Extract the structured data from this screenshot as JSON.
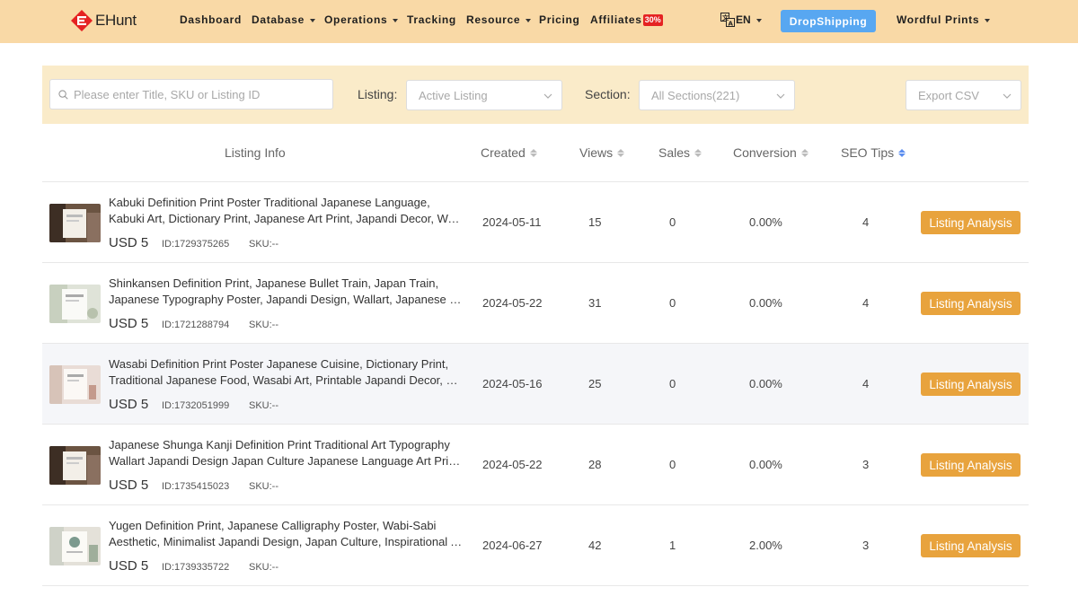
{
  "brand": {
    "name": "EHunt",
    "accent": "#e52222",
    "nav_bg": "#f9d9a6"
  },
  "nav": {
    "items": [
      {
        "label": "Dashboard"
      },
      {
        "label": "Database"
      },
      {
        "label": "Operations"
      },
      {
        "label": "Tracking"
      },
      {
        "label": "Resource"
      },
      {
        "label": "Pricing"
      },
      {
        "label": "Affiliates",
        "badge": "30%"
      }
    ],
    "language": "EN",
    "dropshipping": "DropShipping",
    "shop": "Wordful Prints"
  },
  "filters": {
    "search_placeholder": "Please enter Title, SKU or Listing ID",
    "listing_label": "Listing:",
    "listing_value": "Active Listing",
    "section_label": "Section:",
    "section_value": "All Sections(221)",
    "export_label": "Export CSV"
  },
  "table": {
    "headers": {
      "info": "Listing Info",
      "created": "Created",
      "views": "Views",
      "sales": "Sales",
      "conversion": "Conversion",
      "seo": "SEO Tips"
    },
    "action_label": "Listing Analysis",
    "rows": [
      {
        "title1": "Kabuki Definition Print Poster Traditional Japanese Language,",
        "title2": "Kabuki Art, Dictionary Print, Japanese Art Print, Japandi Decor, Wabi Sabi",
        "price": "USD 5",
        "id": "ID:1729375265",
        "sku": "SKU:--",
        "created": "2024-05-11",
        "views": "15",
        "sales": "0",
        "conversion": "0.00%",
        "seo": "4"
      },
      {
        "title1": "Shinkansen Definition Print, Japanese Bullet Train, Japan Train,",
        "title2": "Japanese Typography Poster, Japandi Design, Wallart, Japanese Language",
        "price": "USD 5",
        "id": "ID:1721288794",
        "sku": "SKU:--",
        "created": "2024-05-22",
        "views": "31",
        "sales": "0",
        "conversion": "0.00%",
        "seo": "4"
      },
      {
        "title1": "Wasabi Definition Print Poster Japanese Cuisine, Dictionary Print,",
        "title2": "Traditional Japanese Food, Wasabi Art, Printable Japandi Decor, Kitchen Art",
        "price": "USD 5",
        "id": "ID:1732051999",
        "sku": "SKU:--",
        "created": "2024-05-16",
        "views": "25",
        "sales": "0",
        "conversion": "0.00%",
        "seo": "4"
      },
      {
        "title1": "Japanese Shunga Kanji Definition Print Traditional Art Typography",
        "title2": "Wallart Japandi Design Japan Culture Japanese Language Art Print Poster",
        "price": "USD 5",
        "id": "ID:1735415023",
        "sku": "SKU:--",
        "created": "2024-05-22",
        "views": "28",
        "sales": "0",
        "conversion": "0.00%",
        "seo": "3"
      },
      {
        "title1": "Yugen Definition Print, Japanese Calligraphy Poster, Wabi-Sabi",
        "title2": "Aesthetic, Minimalist Japandi Design, Japan Culture, Inspirational Art Print",
        "price": "USD 5",
        "id": "ID:1739335722",
        "sku": "SKU:--",
        "created": "2024-06-27",
        "views": "42",
        "sales": "1",
        "conversion": "2.00%",
        "seo": "3"
      }
    ]
  },
  "colors": {
    "button": "#e8a33d",
    "dropship": "#58a7f1",
    "filter_bg": "#faebc9"
  }
}
